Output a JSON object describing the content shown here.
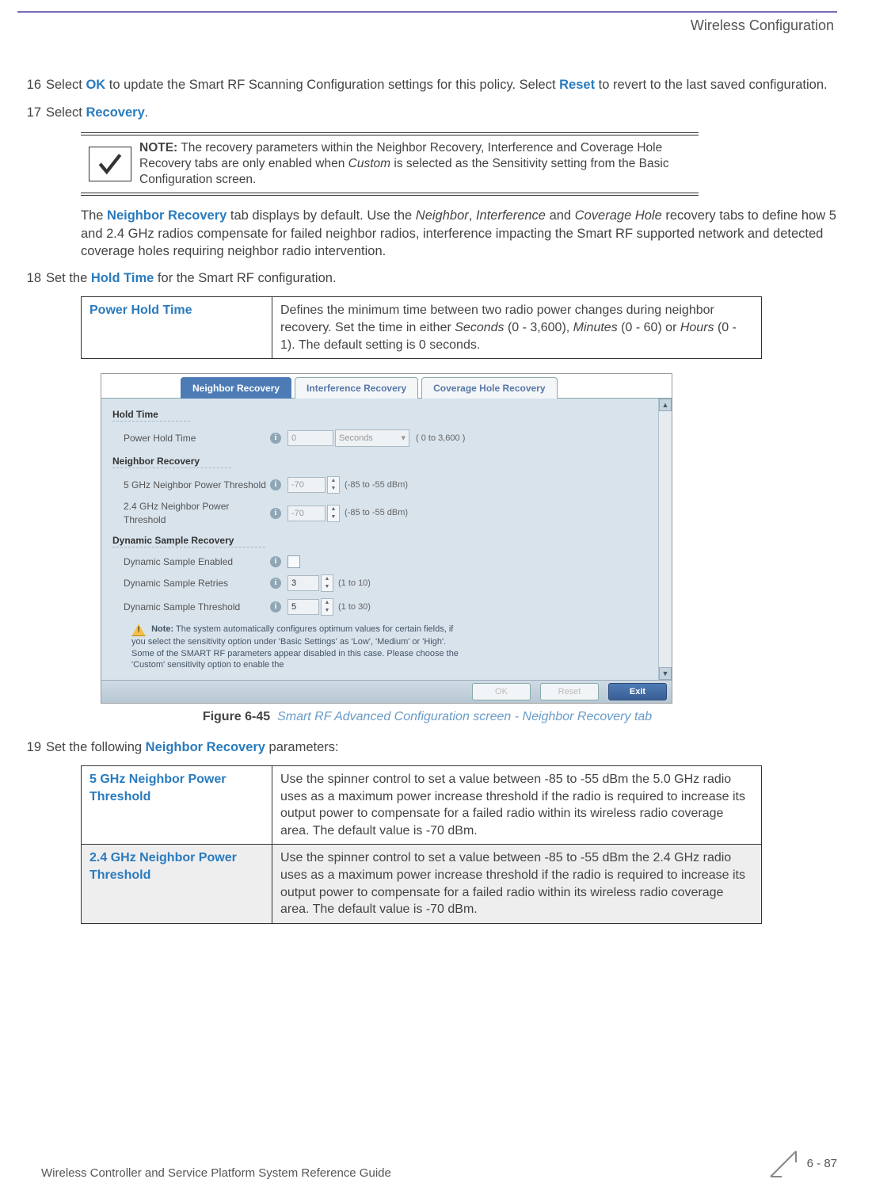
{
  "header": {
    "chapter": "Wireless Configuration"
  },
  "steps": {
    "s16": {
      "num": "16",
      "pre": "Select ",
      "ok": "OK",
      "mid": " to update the Smart RF Scanning Configuration settings for this policy. Select ",
      "reset": "Reset",
      "post": " to revert to the last saved configuration."
    },
    "s17": {
      "num": "17",
      "pre": "Select ",
      "link": "Recovery",
      "post": "."
    },
    "note17": {
      "label": "NOTE:",
      "text_a": " The recovery parameters within the Neighbor Recovery, Interference and Coverage Hole Recovery tabs are only enabled when ",
      "italic": "Custom",
      "text_b": " is selected as the Sensitivity setting from the Basic Configuration screen."
    },
    "post17": {
      "pre": "The ",
      "link": "Neighbor Recovery",
      "a": " tab displays by default. Use the ",
      "i1": "Neighbor",
      "sep1": ", ",
      "i2": "Interference",
      "sep2": " and ",
      "i3": "Coverage Hole",
      "b": " recovery tabs to define how 5 and 2.4 GHz radios compensate for failed neighbor radios, interference impacting the Smart RF supported network and detected coverage holes requiring neighbor radio intervention."
    },
    "s18": {
      "num": "18",
      "pre": "Set the ",
      "link": "Hold Time",
      "post": " for the Smart RF configuration."
    },
    "table18": {
      "label": "Power Hold Time",
      "desc_a": "Defines the minimum time between two radio power changes during neighbor recovery. Set the time in either ",
      "i1": "Seconds",
      "r1": " (0 - 3,600), ",
      "i2": "Minutes",
      "r2": " (0 - 60) or ",
      "i3": "Hours",
      "r3": " (0 - 1). The default setting is 0 seconds."
    },
    "s19": {
      "num": "19",
      "pre": "Set the following ",
      "link": "Neighbor Recovery",
      "post": " parameters:"
    },
    "table19": {
      "row1": {
        "label": "5 GHz Neighbor Power Threshold",
        "desc": "Use the spinner control to set a value between -85 to -55 dBm the 5.0 GHz radio uses as a maximum power increase threshold if the radio is required to increase its output power to compensate for a failed radio within its wireless radio coverage area. The default value is -70 dBm."
      },
      "row2": {
        "label": "2.4 GHz Neighbor Power Threshold",
        "desc": "Use the spinner control to set a value between -85 to -55 dBm the 2.4 GHz radio uses as a maximum power increase threshold if the radio is required to increase its output power to compensate for a failed radio within its wireless radio coverage area. The default value is -70 dBm."
      }
    }
  },
  "ui": {
    "tabs": [
      "Neighbor Recovery",
      "Interference Recovery",
      "Coverage Hole Recovery"
    ],
    "group1": "Hold Time",
    "f1_label": "Power Hold Time",
    "f1_val": "0",
    "f1_unit": "Seconds",
    "f1_range": "( 0 to 3,600 )",
    "group2": "Neighbor Recovery",
    "f2_label": "5 GHz Neighbor Power Threshold",
    "f2_val": "-70",
    "f2_range": "(-85 to -55 dBm)",
    "f3_label": "2.4 GHz Neighbor Power Threshold",
    "f3_val": "-70",
    "f3_range": "(-85 to -55 dBm)",
    "group3": "Dynamic Sample Recovery",
    "f4_label": "Dynamic Sample Enabled",
    "f5_label": "Dynamic Sample Retries",
    "f5_val": "3",
    "f5_range": "(1 to 10)",
    "f6_label": "Dynamic Sample Threshold",
    "f6_val": "5",
    "f6_range": "(1 to 30)",
    "inner_note_label": "Note:",
    "inner_note": " The system automatically configures optimum values for certain fields, if you select the sensitivity option under 'Basic Settings' as 'Low', 'Medium' or 'High'. Some of the SMART RF parameters appear disabled in this case. Please choose the 'Custom' sensitivity option to enable the",
    "btn_ok": "OK",
    "btn_reset": "Reset",
    "btn_exit": "Exit"
  },
  "figure": {
    "label": "Figure 6-45",
    "desc": "Smart RF Advanced Configuration screen - Neighbor Recovery tab"
  },
  "footer": {
    "left": "Wireless Controller and Service Platform System Reference Guide",
    "right": "6 - 87"
  }
}
